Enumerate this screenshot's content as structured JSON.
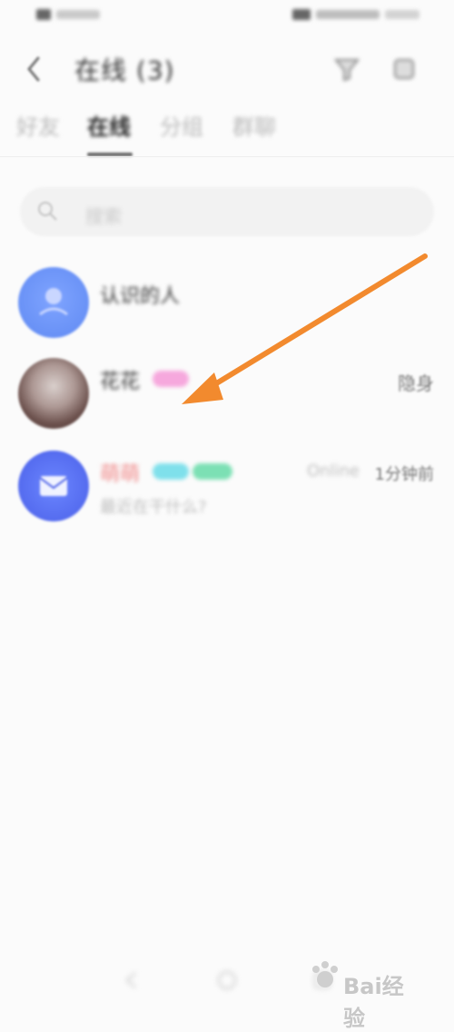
{
  "header": {
    "title": "在线 (3)"
  },
  "tabs": [
    {
      "label": "好友"
    },
    {
      "label": "在线"
    },
    {
      "label": "分组"
    },
    {
      "label": "群聊"
    }
  ],
  "search": {
    "placeholder": "搜索"
  },
  "contacts": [
    {
      "name": "认识的人",
      "type": "group"
    },
    {
      "name": "花花",
      "status": "隐身"
    },
    {
      "name": "萌萌",
      "time": "Online",
      "time_ago": "1分钟前",
      "message": "最近在干什么?"
    }
  ],
  "watermark": {
    "text": "Bai经验"
  },
  "colors": {
    "accent_blue": "#5f89f2",
    "accent_purple": "#4b60e8",
    "tag_pink": "#f6a8dd",
    "tag_cyan": "#7fe0eb",
    "tag_green": "#7ce0b4",
    "name_red": "#f08a8a",
    "annotation_orange": "#f28a2e"
  },
  "icons": {
    "back": "chevron-left-icon",
    "filter": "funnel-icon",
    "settings": "gear-icon",
    "search": "search-icon",
    "annotation_arrow": "arrow-icon"
  }
}
